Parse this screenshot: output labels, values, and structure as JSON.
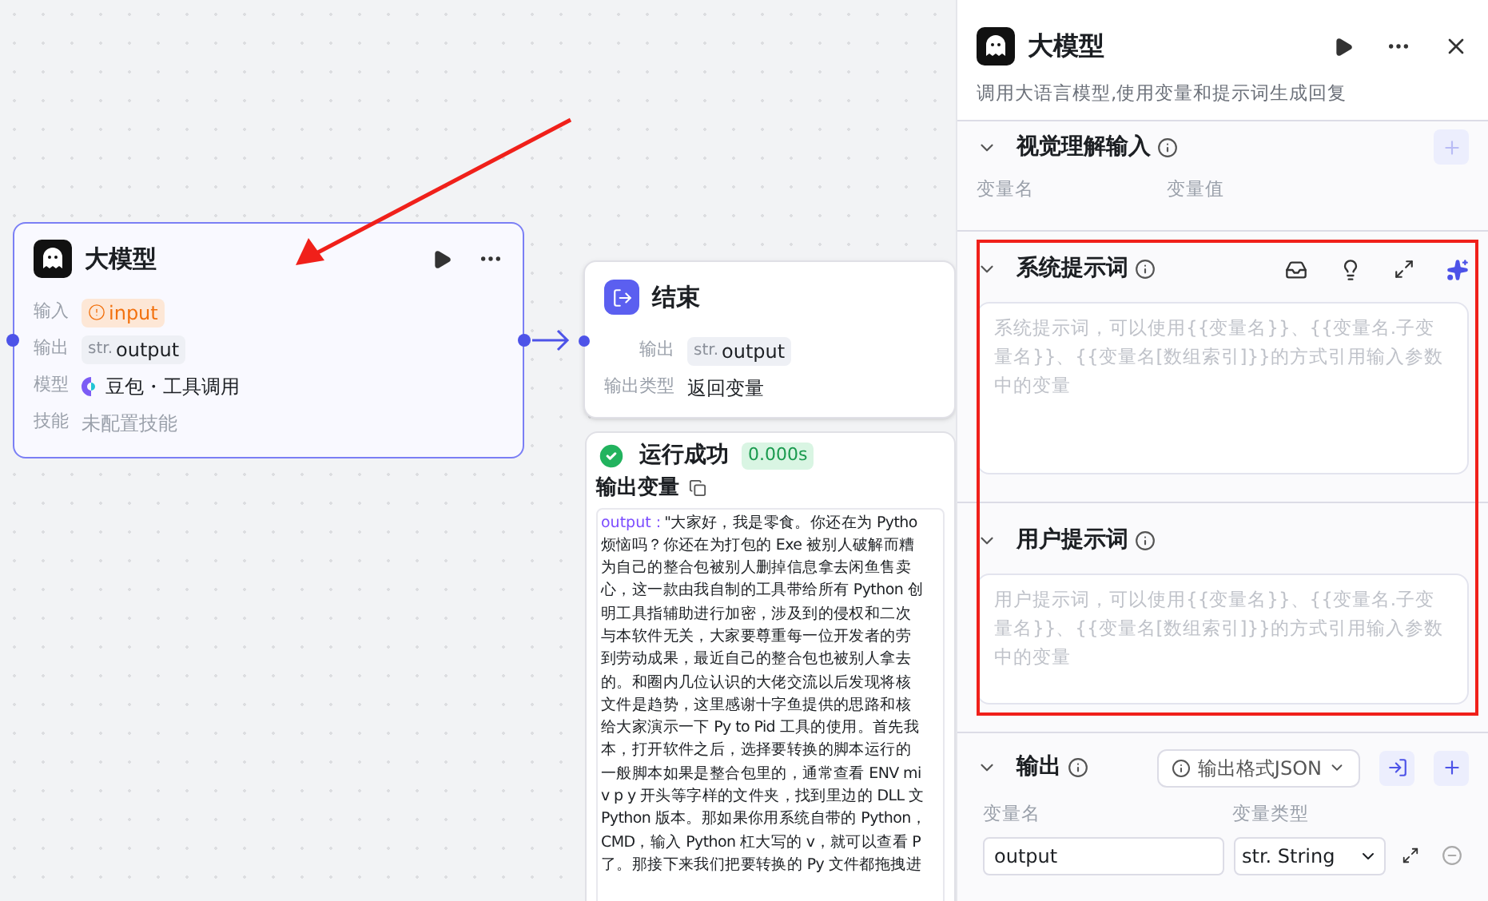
{
  "llm_node": {
    "title": "大模型",
    "selected": true,
    "rows": [
      {
        "kind": "warning",
        "label": "输入",
        "value": "input"
      },
      {
        "kind": "typed",
        "label": "输出",
        "type": "str.",
        "value": "output"
      },
      {
        "kind": "model",
        "label": "模型",
        "value": "豆包・工具调用"
      },
      {
        "kind": "muted",
        "label": "技能",
        "value": "未配置技能"
      }
    ]
  },
  "end_node": {
    "title": "结束",
    "rows": [
      {
        "kind": "typed",
        "label": "输出",
        "type": "str.",
        "value": "output"
      },
      {
        "kind": "plain",
        "label": "输出类型",
        "value": "返回变量"
      }
    ]
  },
  "run_result": {
    "status": "运行成功",
    "duration": "0.000s",
    "section_title": "输出变量",
    "output_key": "output :",
    "lines": [
      "\"大家好，我是零食。你还在为 Pytho",
      "烦恼吗？你还在为打包的 Exe 被别人破解而糟",
      "为自己的整合包被别人删掉信息拿去闲鱼售卖",
      "心，这一款由我自制的工具带给所有 Python 创",
      "明工具指辅助进行加密，涉及到的侵权和二次",
      "与本软件无关，大家要尊重每一位开发者的劳",
      "到劳动成果，最近自己的整合包也被别人拿去",
      "的。和圈内几位认识的大佬交流以后发现将核",
      "文件是趋势，这里感谢十字鱼提供的思路和核",
      "给大家演示一下 Py to Pid 工具的使用。首先我",
      "本，打开软件之后，选择要转换的脚本运行的",
      "一般脚本如果是整合包里的，通常查看 ENV mi",
      "v p y 开头等字样的文件夹，找到里边的 DLL 文",
      "Python 版本。那如果你用系统自带的 Python，",
      "CMD，输入 Python 杠大写的 v，就可以查看 P",
      "了。那接下来我们把要转换的 Py 文件都拖拽进"
    ]
  },
  "panel": {
    "title": "大模型",
    "description": "调用大语言模型,使用变量和提示词生成回复",
    "vision_input": {
      "title": "视觉理解输入",
      "expanded": true,
      "columns": [
        "变量名",
        "变量值"
      ]
    },
    "system_prompt": {
      "title": "系统提示词",
      "expanded": true,
      "placeholder": "系统提示词，可以使用{{变量名}}、{{变量名.子变量名}}、{{变量名[数组索引]}}的方式引用输入参数中的变量"
    },
    "user_prompt": {
      "title": "用户提示词",
      "expanded": true,
      "placeholder": "用户提示词，可以使用{{变量名}}、{{变量名.子变量名}}、{{变量名[数组索引]}}的方式引用输入参数中的变量"
    },
    "output": {
      "title": "输出",
      "expanded": true,
      "format": "输出格式JSON",
      "columns": [
        "变量名",
        "变量类型"
      ],
      "rows": [
        {
          "name": "output",
          "type": "str. String"
        }
      ]
    }
  }
}
